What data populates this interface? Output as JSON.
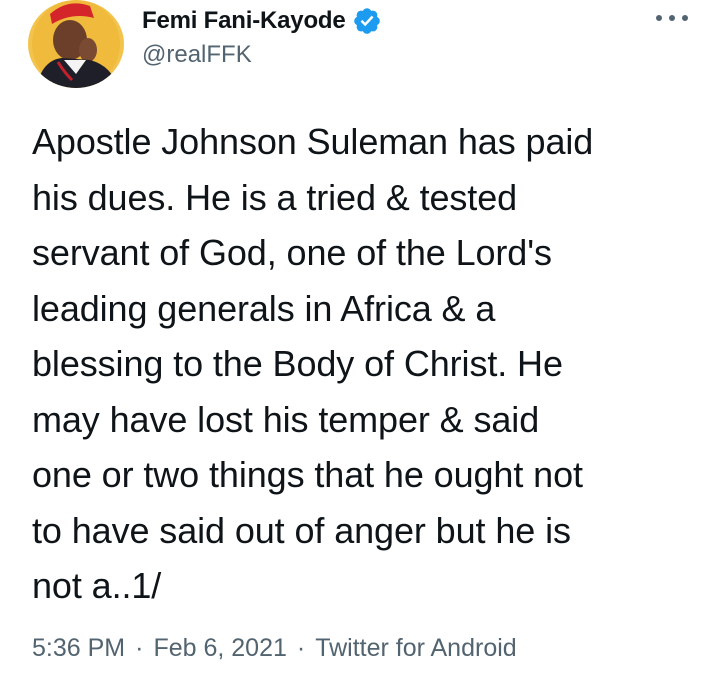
{
  "author": {
    "display_name": "Femi Fani-Kayode",
    "handle": "@realFFK",
    "verified_icon": "verified-badge-icon",
    "badge_color": "#1d9bf0"
  },
  "menu": {
    "icon": "more-options-icon"
  },
  "tweet": {
    "text": "Apostle Johnson Suleman has paid\nhis dues. He is a tried & tested\nservant of God, one of the Lord's\nleading generals in Africa & a\nblessing to the Body of Christ. He\nmay have lost his temper & said\none or two things that he ought not\nto have said out of anger but he is\nnot a..1/"
  },
  "meta": {
    "time": "5:36 PM",
    "date": "Feb 6, 2021",
    "source": "Twitter for Android",
    "separator": "·"
  }
}
